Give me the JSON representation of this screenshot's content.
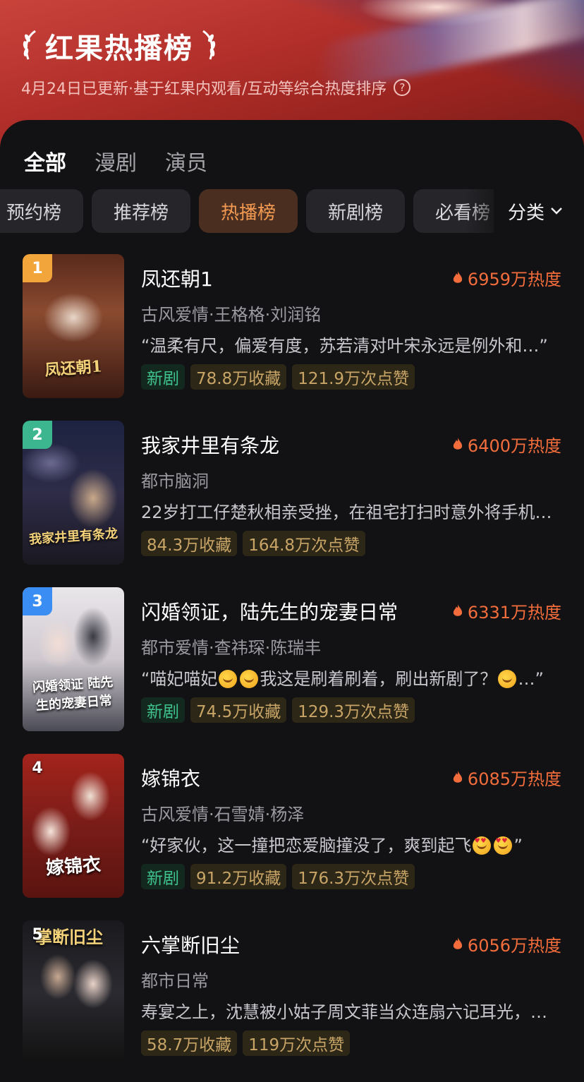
{
  "header": {
    "title": "红果热播榜",
    "subtitle": "4月24日已更新·基于红果内观看/互动等综合热度排序",
    "help_icon": "?"
  },
  "tabs": [
    {
      "label": "全部",
      "active": true
    },
    {
      "label": "漫剧",
      "active": false
    },
    {
      "label": "演员",
      "active": false
    }
  ],
  "chips": [
    {
      "label": "预约榜",
      "active": false
    },
    {
      "label": "推荐榜",
      "active": false
    },
    {
      "label": "热播榜",
      "active": true
    },
    {
      "label": "新剧榜",
      "active": false
    },
    {
      "label": "必看榜",
      "active": false
    }
  ],
  "category": {
    "label": "分类",
    "icon": "chevron-down-icon"
  },
  "items": [
    {
      "rank": "1",
      "title": "凤还朝1",
      "poster_text": "凤还朝1",
      "heat": "6959万热度",
      "meta": "古风爱情·王格格·刘润铭",
      "quote": "“温柔有尺，偏爱有度，苏若清对叶宋永远是例外和…”",
      "new_tag": "新剧",
      "favorites": "78.8万收藏",
      "likes": "121.9万次点赞"
    },
    {
      "rank": "2",
      "title": "我家井里有条龙",
      "poster_text": "我家井里有条龙",
      "heat": "6400万热度",
      "meta": "都市脑洞",
      "quote": "22岁打工仔楚秋相亲受挫，在祖宅打扫时意外将手机…",
      "new_tag": "",
      "favorites": "84.3万收藏",
      "likes": "164.8万次点赞"
    },
    {
      "rank": "3",
      "title": "闪婚领证，陆先生的宠妻日常",
      "poster_text": "闪婚领证 陆先生的宠妻日常",
      "heat": "6331万热度",
      "meta": "都市爱情·查祎琛·陈瑞丰",
      "quote_a": "“喵妃喵妃",
      "quote_b": "我这是刷着刷着，刷出新剧了？",
      "quote_c": "…”",
      "new_tag": "新剧",
      "favorites": "74.5万收藏",
      "likes": "129.3万次点赞"
    },
    {
      "rank": "4",
      "title": "嫁锦衣",
      "poster_text": "嫁锦衣",
      "heat": "6085万热度",
      "meta": "古风爱情·石雪婧·杨泽",
      "quote_a": "“好家伙，这一撞把恋爱脑撞没了，爽到起飞",
      "quote_c": "”",
      "new_tag": "新剧",
      "favorites": "91.2万收藏",
      "likes": "176.3万次点赞"
    },
    {
      "rank": "5",
      "title": "六掌断旧尘",
      "poster_text": "掌断旧尘",
      "heat": "6056万热度",
      "meta": "都市日常",
      "quote": "寿宴之上，沈慧被小姑子周文菲当众连扇六记耳光，…",
      "new_tag": "",
      "favorites": "58.7万收藏",
      "likes": "119万次点赞"
    }
  ],
  "colors": {
    "accent_orange": "#f29a52",
    "heat_red": "#f36d3c",
    "new_green": "#3fc28d",
    "stat_gold": "#c8a567"
  }
}
